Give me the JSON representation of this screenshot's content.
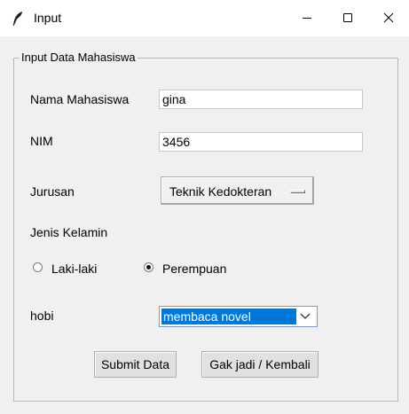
{
  "window": {
    "title": "Input",
    "controls": {
      "minimize": "minimize-icon",
      "maximize": "maximize-icon",
      "close": "close-icon"
    }
  },
  "form": {
    "group_title": "Input Data Mahasiswa",
    "nama_label": "Nama Mahasiswa",
    "nama_value": "gina",
    "nim_label": "NIM",
    "nim_value": "3456",
    "jurusan_label": "Jurusan",
    "jurusan_value": "Teknik Kedokteran",
    "gender_label": "Jenis Kelamin",
    "gender_options": [
      {
        "label": "Laki-laki",
        "selected": false
      },
      {
        "label": "Perempuan",
        "selected": true
      }
    ],
    "hobi_label": "hobi",
    "hobi_value": "membaca novel",
    "submit_label": "Submit Data",
    "back_label": "Gak jadi / Kembali"
  },
  "colors": {
    "selection": "#0078d7",
    "window_bg": "#f0f0f0",
    "titlebar_bg": "#ffffff"
  }
}
